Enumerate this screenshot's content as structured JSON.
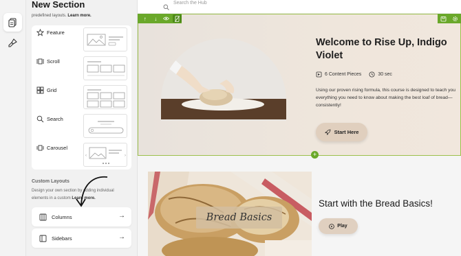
{
  "rail": {
    "items": [
      {
        "icon": "pages-icon",
        "active": true
      },
      {
        "icon": "design-brush-icon",
        "active": false
      }
    ]
  },
  "panel": {
    "title": "New Section",
    "subtitle_prefix": "predefined layouts.",
    "subtitle_link": "Learn more.",
    "layouts": [
      {
        "label": "Feature",
        "icon": "star-icon"
      },
      {
        "label": "Scroll",
        "icon": "scroll-icon"
      },
      {
        "label": "Grid",
        "icon": "grid-icon"
      },
      {
        "label": "Search",
        "icon": "search-icon"
      },
      {
        "label": "Carousel",
        "icon": "carousel-icon"
      }
    ],
    "custom_title": "Custom Layouts",
    "custom_desc_1": "Design your own section by adding individual",
    "custom_desc_2": "elements in a custom",
    "custom_desc_link": "Learn more.",
    "custom_items": [
      {
        "label": "Columns",
        "icon": "columns-icon"
      },
      {
        "label": "Sidebars",
        "icon": "sidebars-icon"
      }
    ]
  },
  "canvas": {
    "search_placeholder": "Search the Hub",
    "hero": {
      "title": "Welcome to Rise Up, Indigo Violet",
      "content_pieces": "6 Content Pieces",
      "duration": "30 sec",
      "description": "Using our proven rising formula, this course is designed to teach you everything you need to know about making the best loaf of bread—consistently!",
      "button_label": "Start Here"
    },
    "section2": {
      "banner_text": "Bread Basics",
      "title": "Start with the Bread Basics!",
      "button_label": "Play"
    }
  },
  "colors": {
    "accent_green": "#6aa82a",
    "hero_bg": "#ede4da",
    "button_tan": "#e0cfbe"
  }
}
